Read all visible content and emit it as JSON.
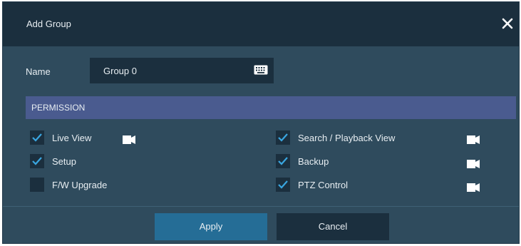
{
  "dialog": {
    "title": "Add Group",
    "close_icon": "close-icon"
  },
  "name": {
    "label": "Name",
    "value": "Group 0",
    "keyboard_icon": "keyboard-icon"
  },
  "permission": {
    "header": "PERMISSION",
    "items": [
      {
        "label": "Live View",
        "checked": true,
        "icon": "camera-icon"
      },
      {
        "label": "Setup",
        "checked": true
      },
      {
        "label": "F/W Upgrade",
        "checked": false
      },
      {
        "label": "Search / Playback View",
        "checked": true,
        "icon": "camera-icon"
      },
      {
        "label": "Backup",
        "checked": true,
        "icon": "camera-icon"
      },
      {
        "label": "PTZ Control",
        "checked": true,
        "icon": "camera-icon"
      }
    ]
  },
  "buttons": {
    "apply": "Apply",
    "cancel": "Cancel"
  },
  "colors": {
    "dialog_bg": "#2f4b5d",
    "titlebar_bg": "#1b2f3e",
    "header_bg": "#4a5b8f",
    "apply_bg": "#256d96",
    "checkmark": "#3aa6e0"
  }
}
